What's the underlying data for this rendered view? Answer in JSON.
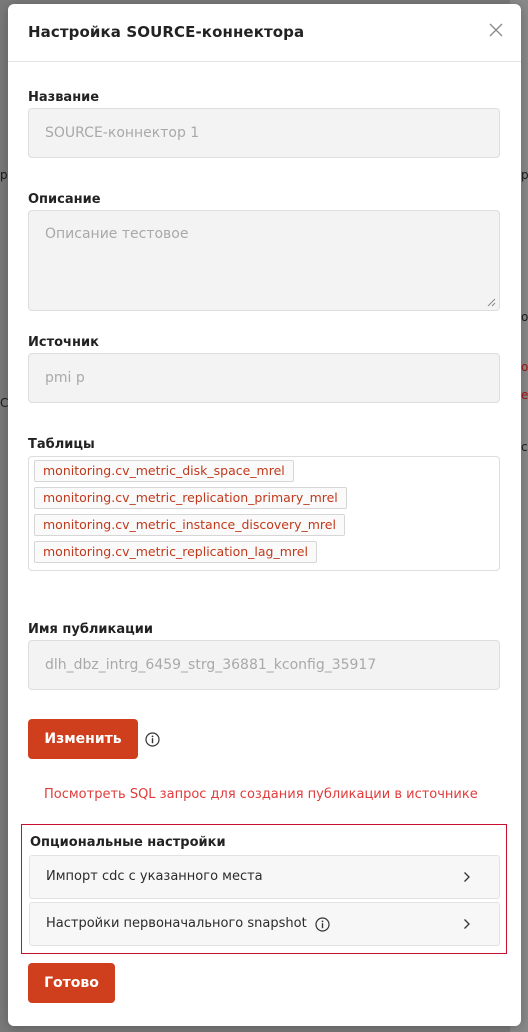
{
  "background": {
    "fragments": [
      "р",
      "С",
      "р",
      "о",
      "о",
      "е",
      "с"
    ]
  },
  "modal": {
    "title": "Настройка SOURCE-коннектора",
    "close_icon": "close-icon"
  },
  "form": {
    "name": {
      "label": "Название",
      "value": "SOURCE-коннектор 1"
    },
    "description": {
      "label": "Описание",
      "value": "Описание тестовое"
    },
    "source": {
      "label": "Источник",
      "value": "pmi p"
    },
    "tables": {
      "label": "Таблицы",
      "items": [
        "monitoring.cv_metric_disk_space_mrel",
        "monitoring.cv_metric_replication_primary_mrel",
        "monitoring.cv_metric_instance_discovery_mrel",
        "monitoring.cv_metric_replication_lag_mrel"
      ]
    },
    "publication": {
      "label": "Имя публикации",
      "value": "dlh_dbz_intrg_6459_strg_36881_kconfig_35917"
    },
    "change_button": "Изменить",
    "sql_link": "Посмотреть SQL запрос для создания публикации в источнике"
  },
  "optional": {
    "title": "Опциональные настройки",
    "rows": [
      {
        "label": "Импорт cdc с указанного места"
      },
      {
        "label": "Настройки первоначального snapshot"
      }
    ]
  },
  "done_button": "Готово",
  "colors": {
    "accent": "#d03f1d",
    "tag_text": "#c0391b",
    "link": "#e03b3b",
    "highlight_border": "#c8102e"
  }
}
